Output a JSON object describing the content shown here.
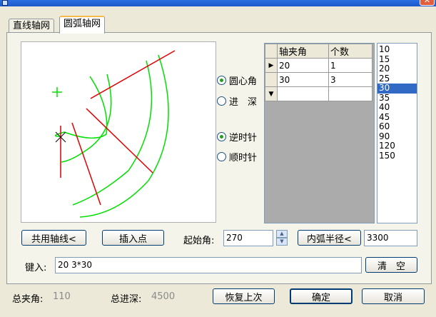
{
  "tabs": [
    "直线轴网",
    "圆弧轴网"
  ],
  "radios": {
    "center_angle": "圆心角",
    "depth": "进　深",
    "ccw": "逆时针",
    "cw": "顺时针"
  },
  "grid": {
    "headers": [
      "轴夹角",
      "个数"
    ],
    "rows": [
      [
        "20",
        "1"
      ],
      [
        "30",
        "3"
      ]
    ]
  },
  "angle_list": [
    "10",
    "15",
    "20",
    "25",
    "30",
    "35",
    "40",
    "45",
    "60",
    "90",
    "120",
    "150"
  ],
  "angle_list_selected": "30",
  "buttons": {
    "shared_axis": "共用轴线<",
    "insert_point": "插入点",
    "inner_radius": "内弧半径<",
    "clear": "清　空",
    "restore": "恢复上次",
    "ok": "确定",
    "cancel": "取消"
  },
  "start_angle": {
    "label": "起始角:",
    "value": "270"
  },
  "inner_radius_value": "3300",
  "input": {
    "label": "键入:",
    "value": "20  3*30"
  },
  "totals": {
    "angle_label": "总夹角:",
    "angle_value": "110",
    "depth_label": "总进深:",
    "depth_value": "4500"
  },
  "colors": {
    "arc": "#00e000",
    "axis": "#e00000",
    "accent": "#316ac5"
  }
}
